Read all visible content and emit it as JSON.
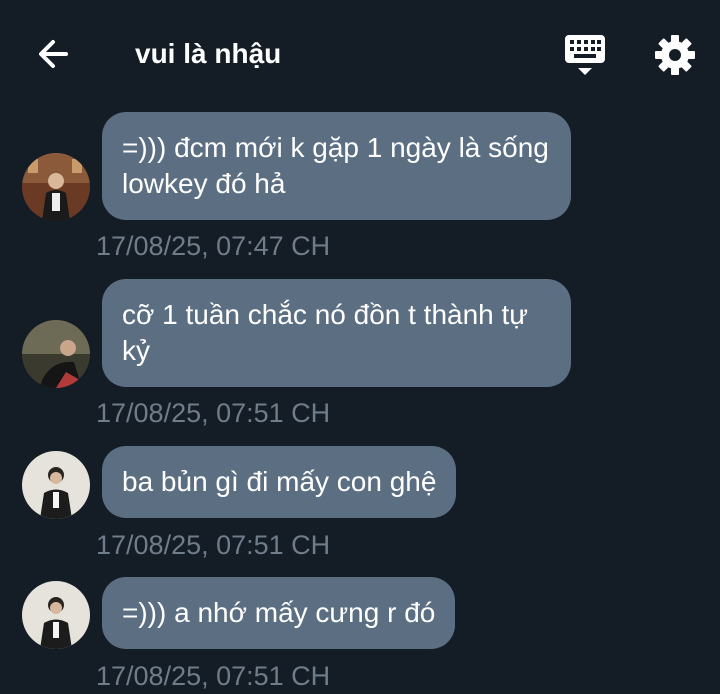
{
  "header": {
    "title": "vui là nhậu",
    "icons": [
      "arrow-left-icon",
      "keyboard-icon",
      "gear-icon"
    ]
  },
  "colors": {
    "background": "#141c26",
    "bubble": "#5c6f82",
    "timestamp": "#6f7c8a",
    "text": "#ffffff"
  },
  "messages": [
    {
      "text": "=))) đcm mới k gặp 1 ngày là sống lowkey đó hả",
      "time": "17/08/25, 07:47 CH"
    },
    {
      "text": "cỡ 1 tuần chắc nó đồn t thành tự kỷ",
      "time": "17/08/25, 07:51 CH"
    },
    {
      "text": "ba bủn gì đi mấy con ghệ",
      "time": "17/08/25, 07:51 CH"
    },
    {
      "text": "=))) a nhớ mấy cưng r đó",
      "time": "17/08/25, 07:51 CH"
    }
  ]
}
